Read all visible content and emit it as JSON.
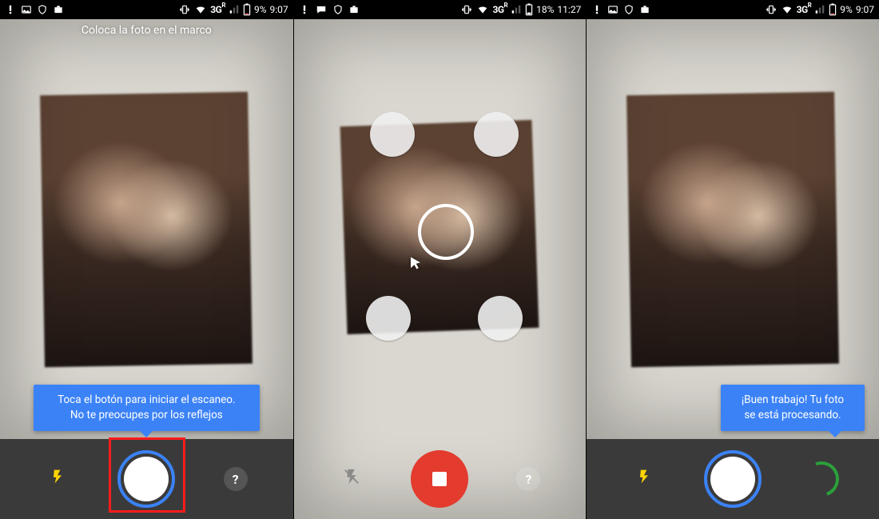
{
  "screens": [
    {
      "status": {
        "network": "3G",
        "roaming": "R",
        "battery_pct": "9%",
        "time": "9:07"
      },
      "title": "Coloca la foto en el marco",
      "tooltip": {
        "line1": "Toca el botón para iniciar el escaneo.",
        "line2": "No te preocupes por los reflejos"
      },
      "controls": {
        "help": "?"
      }
    },
    {
      "status": {
        "network": "3G",
        "roaming": "R",
        "battery_pct": "18%",
        "time": "11:27"
      },
      "controls": {
        "help": "?"
      }
    },
    {
      "status": {
        "network": "3G",
        "roaming": "R",
        "battery_pct": "9%",
        "time": "9:07"
      },
      "tooltip": {
        "line1": "¡Buen trabajo! Tu foto",
        "line2": "se está procesando."
      },
      "controls": {
        "help": "?"
      }
    }
  ]
}
